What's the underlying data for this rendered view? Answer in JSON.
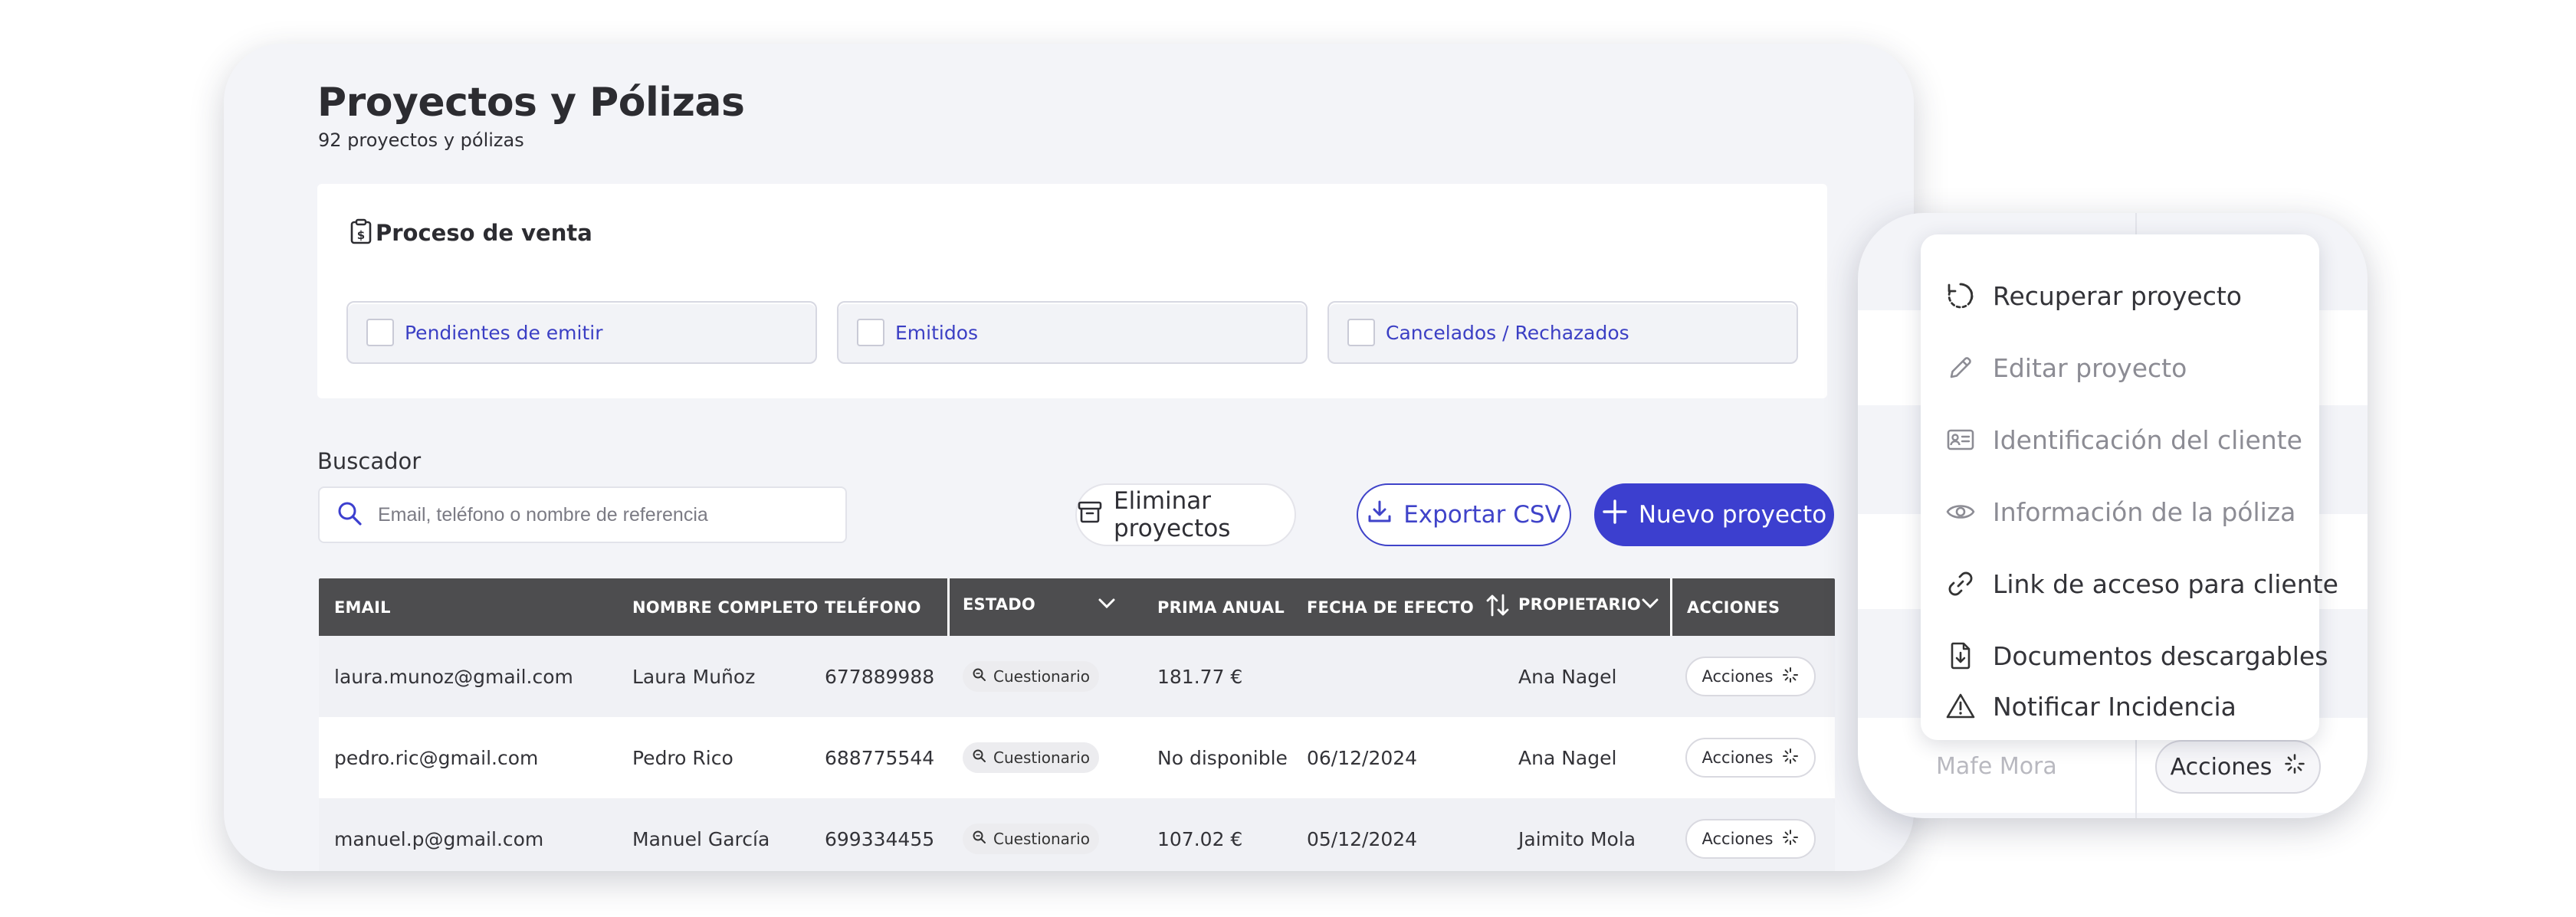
{
  "page": {
    "title": "Proyectos y Pólizas",
    "subtitle": "92 proyectos y pólizas"
  },
  "sales_process": {
    "label": "Proceso de venta",
    "filters": [
      {
        "label": "Pendientes de emitir",
        "checked": false
      },
      {
        "label": "Emitidos",
        "checked": false
      },
      {
        "label": "Cancelados / Rechazados",
        "checked": false
      }
    ]
  },
  "search": {
    "label": "Buscador",
    "placeholder": "Email, teléfono o nombre de referencia",
    "value": ""
  },
  "toolbar": {
    "delete_label": "Eliminar proyectos",
    "export_label": "Exportar CSV",
    "new_label": "Nuevo proyecto"
  },
  "table": {
    "columns": {
      "email": "EMAIL",
      "name": "NOMBRE COMPLETO",
      "phone": "TELÉFONO",
      "status": "ESTADO",
      "premium": "PRIMA ANUAL",
      "date": "FECHA DE EFECTO",
      "owner": "PROPIETARIO",
      "actions": "ACCIONES"
    },
    "rows": [
      {
        "email": "laura.munoz@gmail.com",
        "name": "Laura Muñoz",
        "phone": "677889988",
        "status": "Cuestionario",
        "premium": "181.77 €",
        "date": "",
        "owner": "Ana Nagel",
        "actions": "Acciones"
      },
      {
        "email": "pedro.ric@gmail.com",
        "name": "Pedro Rico",
        "phone": "688775544",
        "status": "Cuestionario",
        "premium": "No disponible",
        "date": "06/12/2024",
        "owner": "Ana Nagel",
        "actions": "Acciones"
      },
      {
        "email": "manuel.p@gmail.com",
        "name": "Manuel García",
        "phone": "699334455",
        "status": "Cuestionario",
        "premium": "107.02 €",
        "date": "05/12/2024",
        "owner": "Jaimito Mola",
        "actions": "Acciones"
      }
    ]
  },
  "popup": {
    "menu": [
      {
        "label": "Recuperar proyecto",
        "icon": "restore-icon",
        "enabled": true
      },
      {
        "label": "Editar proyecto",
        "icon": "pencil-icon",
        "enabled": false
      },
      {
        "label": "Identificación del cliente",
        "icon": "id-card-icon",
        "enabled": false
      },
      {
        "label": "Información de la póliza",
        "icon": "eye-icon",
        "enabled": false
      },
      {
        "label": "Link de acceso para cliente",
        "icon": "link-icon",
        "enabled": true
      },
      {
        "label": "Documentos descargables",
        "icon": "file-download-icon",
        "enabled": true
      },
      {
        "label": "Notificar Incidencia",
        "icon": "warning-icon",
        "enabled": true
      }
    ],
    "ghost_name": "Mafe Mora",
    "actions_label": "Acciones"
  },
  "colors": {
    "accent": "#3c3fcf",
    "header": "#4d4d4f",
    "filter_text": "#3b3fc4"
  }
}
